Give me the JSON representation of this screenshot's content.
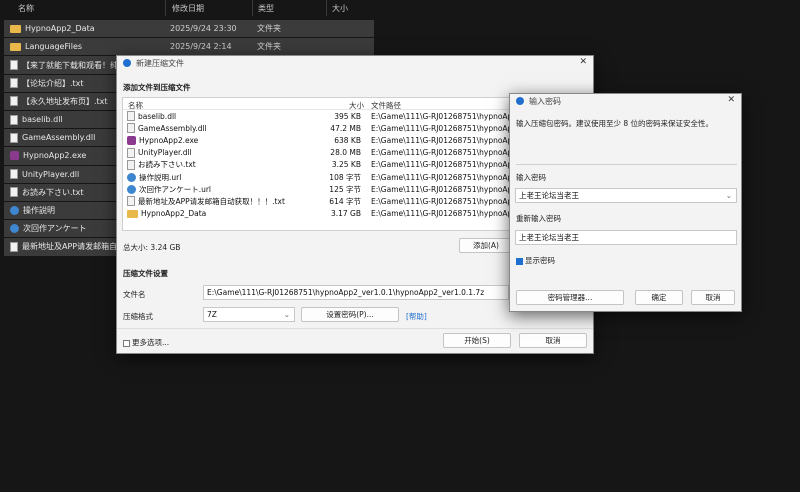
{
  "explorer": {
    "columns": [
      "名称",
      "修改日期",
      "类型",
      "大小"
    ],
    "rows": [
      {
        "name": "HypnoApp2_Data",
        "date": "2025/9/24 23:30",
        "type": "文件夹",
        "icon": "folder-icon"
      },
      {
        "name": "LanguageFiles",
        "date": "2025/9/24 2:14",
        "type": "文件夹",
        "icon": "folder-icon"
      },
      {
        "name": "【来了就能下载和观看！纯免",
        "date": "",
        "type": "",
        "icon": "text-file-icon"
      },
      {
        "name": "【论坛介绍】.txt",
        "date": "",
        "type": "",
        "icon": "text-file-icon"
      },
      {
        "name": "【永久地址发布页】.txt",
        "date": "",
        "type": "",
        "icon": "text-file-icon"
      },
      {
        "name": "baselib.dll",
        "date": "",
        "type": "",
        "icon": "dll-file-icon"
      },
      {
        "name": "GameAssembly.dll",
        "date": "",
        "type": "",
        "icon": "dll-file-icon"
      },
      {
        "name": "HypnoApp2.exe",
        "date": "",
        "type": "",
        "icon": "app-exe-icon"
      },
      {
        "name": "UnityPlayer.dll",
        "date": "",
        "type": "",
        "icon": "dll-file-icon"
      },
      {
        "name": "お読み下さい.txt",
        "date": "",
        "type": "",
        "icon": "text-file-icon"
      },
      {
        "name": "操作説明",
        "date": "",
        "type": "",
        "icon": "url-globe-icon"
      },
      {
        "name": "次回作アンケート",
        "date": "",
        "type": "",
        "icon": "url-globe-icon"
      },
      {
        "name": "最新地址及APP请发邮箱自动",
        "date": "",
        "type": "",
        "icon": "text-file-icon"
      }
    ]
  },
  "archive_dialog": {
    "title": "新建压缩文件",
    "section_add": "添加文件到压缩文件",
    "col_name": "名称",
    "col_size": "大小",
    "col_path": "文件路径",
    "files": [
      {
        "name": "baselib.dll",
        "size": "395 KB",
        "path": "E:\\Game\\111\\G-RJ01268751\\hypnoApp2",
        "icon": "dll-file-icon"
      },
      {
        "name": "GameAssembly.dll",
        "size": "47.2 MB",
        "path": "E:\\Game\\111\\G-RJ01268751\\hypnoApp2",
        "icon": "dll-file-icon"
      },
      {
        "name": "HypnoApp2.exe",
        "size": "638 KB",
        "path": "E:\\Game\\111\\G-RJ01268751\\hypnoApp2",
        "icon": "app-exe-icon"
      },
      {
        "name": "UnityPlayer.dll",
        "size": "28.0 MB",
        "path": "E:\\Game\\111\\G-RJ01268751\\hypnoApp2",
        "icon": "dll-file-icon"
      },
      {
        "name": "お読み下さい.txt",
        "size": "3.25 KB",
        "path": "E:\\Game\\111\\G-RJ01268751\\hypnoApp2",
        "icon": "text-file-icon"
      },
      {
        "name": "操作説明.url",
        "size": "108 字节",
        "path": "E:\\Game\\111\\G-RJ01268751\\hypnoApp2",
        "icon": "url-globe-icon"
      },
      {
        "name": "次回作アンケート.url",
        "size": "125 字节",
        "path": "E:\\Game\\111\\G-RJ01268751\\hypnoApp2",
        "icon": "url-globe-icon"
      },
      {
        "name": "最新地址及APP请发邮箱自动获取！！！.txt",
        "size": "614 字节",
        "path": "E:\\Game\\111\\G-RJ01268751\\hypnoApp2",
        "icon": "text-file-icon"
      },
      {
        "name": "HypnoApp2_Data",
        "size": "3.17 GB",
        "path": "E:\\Game\\111\\G-RJ01268751\\hypnoApp2",
        "icon": "folder-icon"
      }
    ],
    "total_size": "总大小: 3.24 GB",
    "add_button": "添加(A)",
    "section_settings": "压缩文件设置",
    "filename_label": "文件名",
    "filename_value": "E:\\Game\\111\\G-RJ01268751\\hypnoApp2_ver1.0.1\\hypnoApp2_ver1.0.1.7z",
    "format_label": "压缩格式",
    "format_value": "7Z",
    "set_password_button": "设置密码(P)...",
    "help_link": "[帮助]",
    "more_options": "更多选项...",
    "start_button": "开始(S)",
    "cancel_button": "取消"
  },
  "password_dialog": {
    "title": "输入密码",
    "description": "输入压缩包密码。建议使用至少 8 位的密码来保证安全性。",
    "password_label": "输入密码",
    "password_value": "上老王论坛当老王",
    "reenter_label": "重新输入密码",
    "reenter_value": "上老王论坛当老王",
    "show_password": "显示密码",
    "show_password_checked": true,
    "manager_button": "密码管理器...",
    "ok_button": "确定",
    "cancel_button": "取消"
  }
}
